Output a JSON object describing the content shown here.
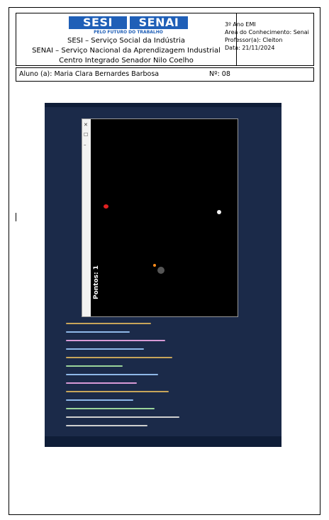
{
  "header": {
    "logo_left": "SESI",
    "logo_right": "SENAI",
    "tagline": "PELO FUTURO DO TRABALHO",
    "inst_line1": "SESI – Serviço Social da Indústria",
    "inst_line2": "SENAI – Serviço Nacional da Aprendizagem Industrial",
    "inst_line3": "Centro Integrado Senador Nilo Coelho",
    "info": [
      "3º Ano EMI",
      "Area do Conhecimento: Senai",
      "Professor(a): Cleiton",
      "Data: 21/11/2024"
    ]
  },
  "student": {
    "name": "Aluno (a): Maria Clara Bernardes Barbosa",
    "number": "Nº: 08"
  },
  "game": {
    "score": "Pontos: 1"
  },
  "colors": {
    "logo_blue": "#1f5fb7",
    "ide_bg": "#1b2a49"
  }
}
